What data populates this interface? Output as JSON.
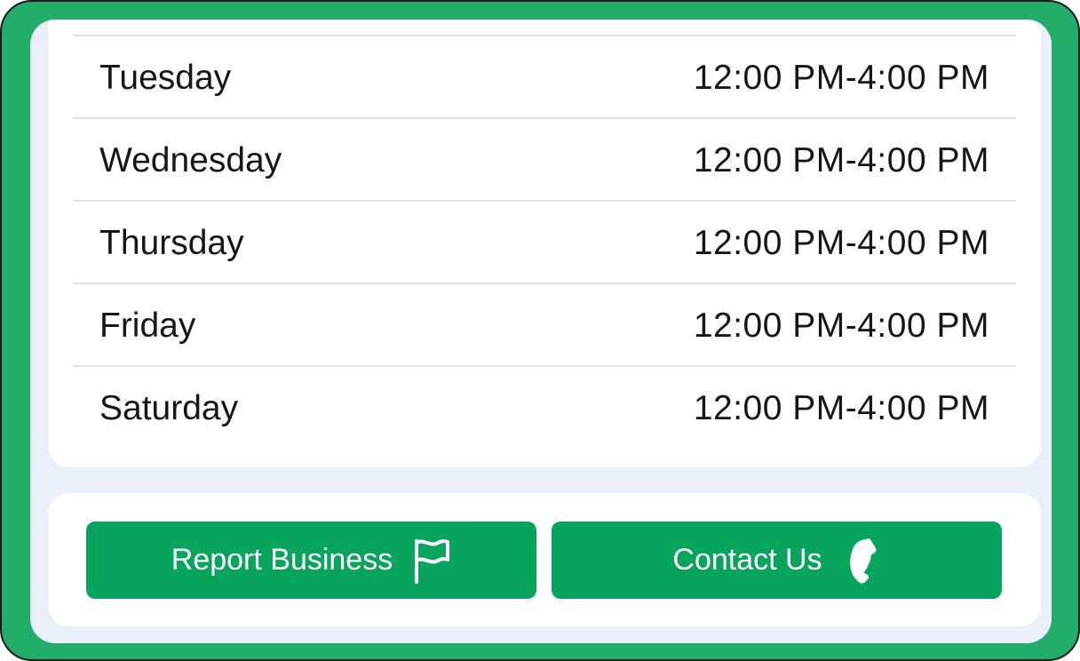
{
  "hours": [
    {
      "day": "Tuesday",
      "time": "12:00 PM-4:00 PM"
    },
    {
      "day": "Wednesday",
      "time": "12:00 PM-4:00 PM"
    },
    {
      "day": "Thursday",
      "time": "12:00 PM-4:00 PM"
    },
    {
      "day": "Friday",
      "time": "12:00 PM-4:00 PM"
    },
    {
      "day": "Saturday",
      "time": "12:00 PM-4:00 PM"
    }
  ],
  "actions": {
    "report_label": "Report Business",
    "report_icon": "flag-icon",
    "contact_label": "Contact Us",
    "contact_icon": "phone-icon"
  },
  "colors": {
    "frame": "#22ad6a",
    "button": "#06a45c",
    "screen_background": "#e9f0fb"
  }
}
